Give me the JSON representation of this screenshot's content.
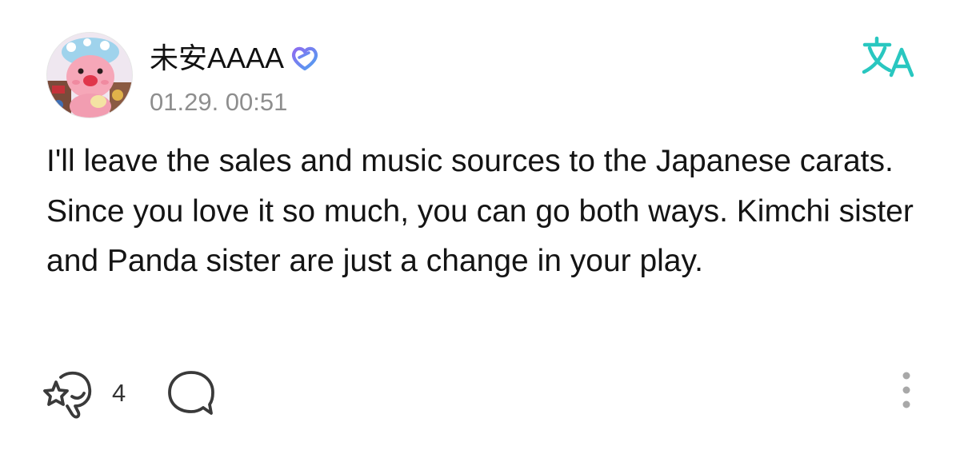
{
  "post": {
    "author": {
      "name": "未安AAAA",
      "verified_icon": "membership-badge-icon"
    },
    "timestamp": "01.29. 00:51",
    "body": "I'll leave the sales and music sources to the Japanese carats. Since you love it so much, you can go both ways. Kimchi sister and Panda sister are just a change in your play.",
    "actions": {
      "reaction_icon": "reaction-add-icon",
      "reaction_count": "4",
      "comment_icon": "comment-bubble-icon",
      "more_icon": "more-vertical-icon",
      "translate_icon": "translate-icon"
    }
  },
  "colors": {
    "accent": "#29c7c0",
    "badge_blue": "#5b8cf0",
    "badge_purple": "#8d6cf0",
    "text_primary": "#111111",
    "text_secondary": "#8e8e8e",
    "icon": "#3a3a3a",
    "more_dots": "#a8a8a8"
  }
}
